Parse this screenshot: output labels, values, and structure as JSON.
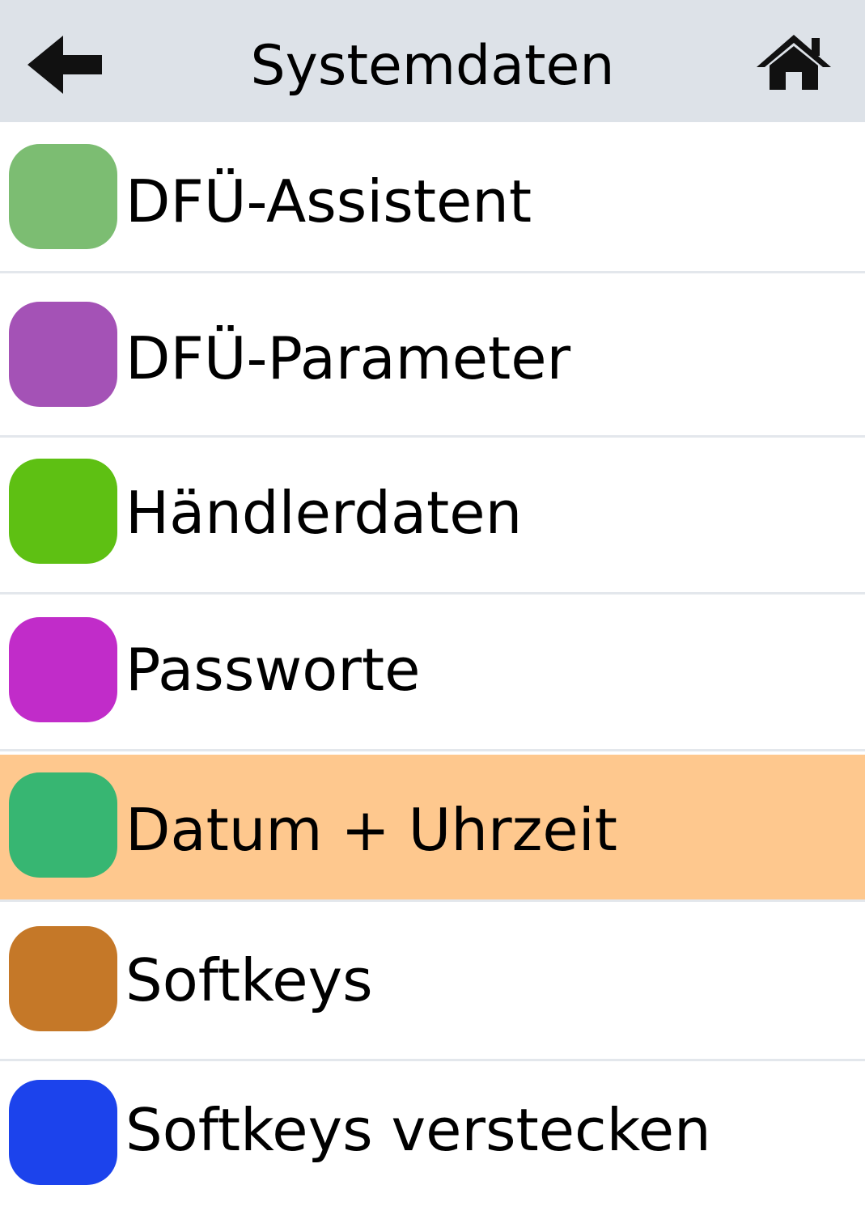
{
  "header": {
    "title": "Systemdaten",
    "back_icon": "arrow-left-icon",
    "home_icon": "home-icon"
  },
  "menu": {
    "items": [
      {
        "label": "DFÜ-Assistent",
        "color": "#7cbd72",
        "selected": false
      },
      {
        "label": "DFÜ-Parameter",
        "color": "#a452b6",
        "selected": false
      },
      {
        "label": "Händlerdaten",
        "color": "#5ec013",
        "selected": false
      },
      {
        "label": "Passworte",
        "color": "#c12cc9",
        "selected": false
      },
      {
        "label": "Datum + Uhrzeit",
        "color": "#37b672",
        "selected": true
      },
      {
        "label": "Softkeys",
        "color": "#c57828",
        "selected": false
      },
      {
        "label": "Softkeys verstecken",
        "color": "#1c43ec",
        "selected": false
      }
    ],
    "selected_background": "#fec88e"
  }
}
